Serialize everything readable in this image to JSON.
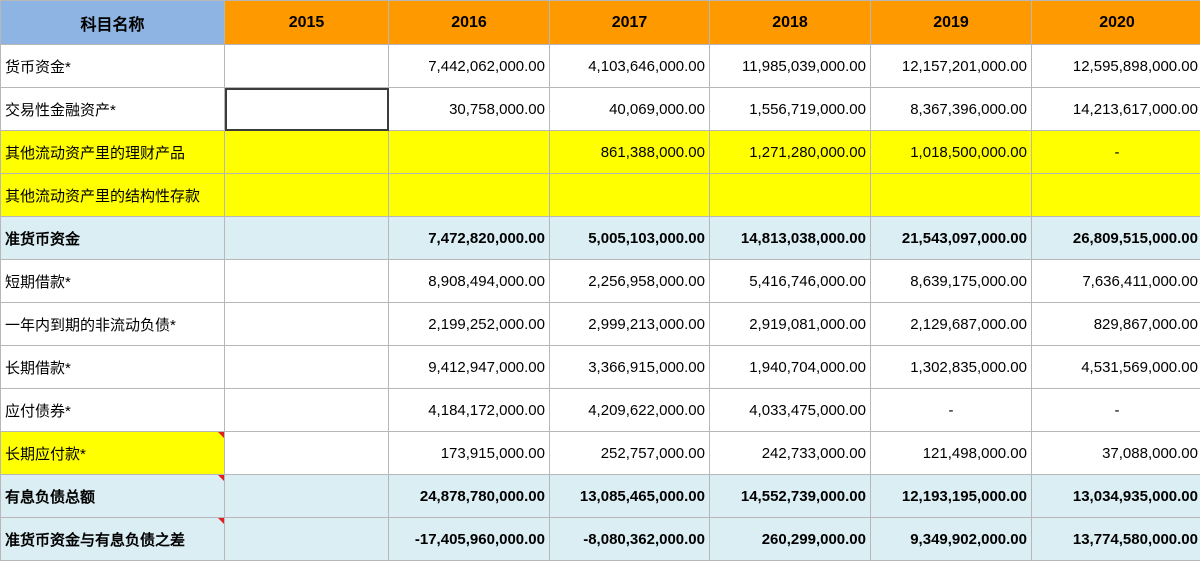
{
  "columns": [
    "科目名称",
    "2015",
    "2016",
    "2017",
    "2018",
    "2019",
    "2020"
  ],
  "rows": [
    {
      "label": "货币资金*",
      "values": [
        "",
        "7,442,062,000.00",
        "4,103,646,000.00",
        "11,985,039,000.00",
        "12,157,201,000.00",
        "12,595,898,000.00"
      ]
    },
    {
      "label": "交易性金融资产*",
      "values": [
        "",
        "30,758,000.00",
        "40,069,000.00",
        "1,556,719,000.00",
        "8,367,396,000.00",
        "14,213,617,000.00"
      ]
    },
    {
      "label": "其他流动资产里的理财产品",
      "values": [
        "",
        "",
        "861,388,000.00",
        "1,271,280,000.00",
        "1,018,500,000.00",
        "-"
      ]
    },
    {
      "label": "其他流动资产里的结构性存款",
      "values": [
        "",
        "",
        "",
        "",
        "",
        ""
      ]
    },
    {
      "label": "准货币资金",
      "values": [
        "",
        "7,472,820,000.00",
        "5,005,103,000.00",
        "14,813,038,000.00",
        "21,543,097,000.00",
        "26,809,515,000.00"
      ]
    },
    {
      "label": "短期借款*",
      "values": [
        "",
        "8,908,494,000.00",
        "2,256,958,000.00",
        "5,416,746,000.00",
        "8,639,175,000.00",
        "7,636,411,000.00"
      ]
    },
    {
      "label": "一年内到期的非流动负债*",
      "values": [
        "",
        "2,199,252,000.00",
        "2,999,213,000.00",
        "2,919,081,000.00",
        "2,129,687,000.00",
        "829,867,000.00"
      ]
    },
    {
      "label": "长期借款*",
      "values": [
        "",
        "9,412,947,000.00",
        "3,366,915,000.00",
        "1,940,704,000.00",
        "1,302,835,000.00",
        "4,531,569,000.00"
      ]
    },
    {
      "label": "应付债券*",
      "values": [
        "",
        "4,184,172,000.00",
        "4,209,622,000.00",
        "4,033,475,000.00",
        "-",
        "-"
      ]
    },
    {
      "label": "长期应付款*",
      "values": [
        "",
        "173,915,000.00",
        "252,757,000.00",
        "242,733,000.00",
        "121,498,000.00",
        "37,088,000.00"
      ]
    },
    {
      "label": "有息负债总额",
      "values": [
        "",
        "24,878,780,000.00",
        "13,085,465,000.00",
        "14,552,739,000.00",
        "12,193,195,000.00",
        "13,034,935,000.00"
      ]
    },
    {
      "label": "准货币资金与有息负债之差",
      "values": [
        "",
        "-17,405,960,000.00",
        "-8,080,362,000.00",
        "260,299,000.00",
        "9,349,902,000.00",
        "13,774,580,000.00"
      ]
    }
  ],
  "colors": {
    "header_first": "#8db4e2",
    "header": "#ff9900",
    "highlight_yellow": "#ffff00",
    "highlight_blue": "#daeef3",
    "comment_marker": "#e02020"
  }
}
